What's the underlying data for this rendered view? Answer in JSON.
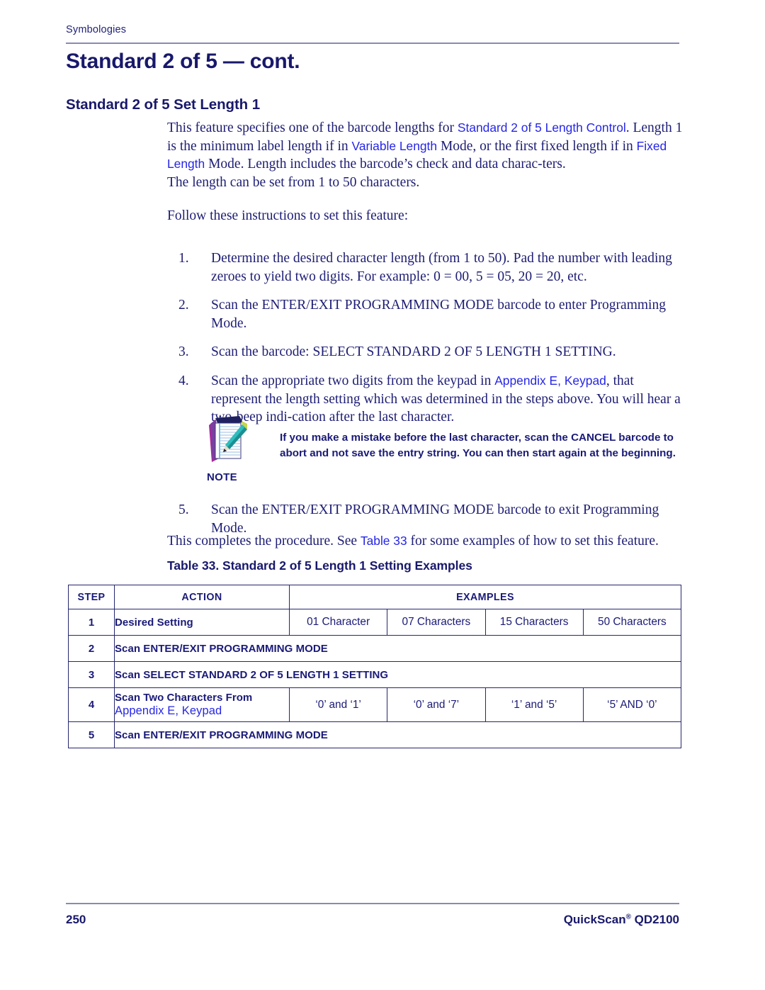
{
  "header": {
    "running_head": "Symbologies",
    "chapter_title": "Standard 2 of 5 — cont.",
    "section_title": "Standard 2 of 5 Set Length 1"
  },
  "intro": {
    "p1_a": "This feature specifies one of the barcode lengths for ",
    "p1_link1": "Standard 2 of 5 Length Control",
    "p1_b": ". Length 1 is the minimum label length if in ",
    "p1_link2": "Variable Length",
    "p1_c": " Mode, or the first fixed length if in ",
    "p1_link3": "Fixed Length",
    "p1_d": " Mode. Length includes the barcode’s check and data charac-ters.",
    "p2": "The length can be set from 1 to 50 characters.",
    "p3": "Follow these instructions to set this feature:"
  },
  "steps": [
    {
      "num": "1.",
      "text": "Determine the desired character length (from 1 to 50). Pad the number with leading zeroes to yield two digits. For example: 0 = 00, 5 = 05, 20 = 20, etc."
    },
    {
      "num": "2.",
      "text": "Scan the ENTER/EXIT PROGRAMMING MODE barcode to enter Programming Mode."
    },
    {
      "num": "3.",
      "text": "Scan the barcode: SELECT STANDARD 2 OF 5 LENGTH 1 SETTING."
    },
    {
      "num": "4.",
      "text_a": "Scan the appropriate two digits from the keypad in ",
      "link": "Appendix E, Keypad",
      "text_b": ", that represent the length setting which was determined in the steps above. You will hear a two-beep indi-cation after the last character."
    }
  ],
  "note": {
    "icon": "notepad-pencil-icon",
    "text": "If you make a mistake before the last character, scan the CANCEL barcode to abort and not save the entry string. You can then start again at the beginning.",
    "label": "NOTE"
  },
  "steps_after_note": [
    {
      "num": "5.",
      "text": "Scan the ENTER/EXIT PROGRAMMING MODE barcode to exit Programming Mode."
    }
  ],
  "closing": {
    "text_a": "This completes the procedure. See ",
    "link": "Table 33",
    "text_b": " for some examples of how to set this feature."
  },
  "table": {
    "caption": "Table 33. Standard 2 of 5 Length 1 Setting Examples",
    "headers": {
      "step": "STEP",
      "action": "ACTION",
      "examples": "EXAMPLES"
    },
    "rows": [
      {
        "step": "1",
        "action": "Desired Setting",
        "action_link": "",
        "examples": [
          "01 Character",
          "07 Characters",
          "15 Characters",
          "50 Characters"
        ]
      },
      {
        "step": "2",
        "action": "Scan ENTER/EXIT PROGRAMMING MODE",
        "action_link": "",
        "examples": []
      },
      {
        "step": "3",
        "action": "Scan SELECT STANDARD 2 OF 5 LENGTH 1 SETTING",
        "action_link": "",
        "examples": []
      },
      {
        "step": "4",
        "action": "Scan Two Characters From",
        "action_link": "Appendix E, Keypad",
        "examples": [
          "‘0’ and ‘1’",
          "‘0’ and ‘7’",
          "‘1’ and ‘5’",
          "‘5’ AND ‘0’"
        ]
      },
      {
        "step": "5",
        "action": "Scan ENTER/EXIT PROGRAMMING MODE",
        "action_link": "",
        "examples": []
      }
    ]
  },
  "footer": {
    "page_number": "250",
    "product_name": "QuickScan",
    "product_mark": "®",
    "product_model": " QD2100"
  },
  "colors": {
    "body_navy": "#1d1d74",
    "heading_navy": "#18186b",
    "link_blue": "#2626e6",
    "rule_purple": "#8a8ab4",
    "table_border": "#26266e"
  }
}
